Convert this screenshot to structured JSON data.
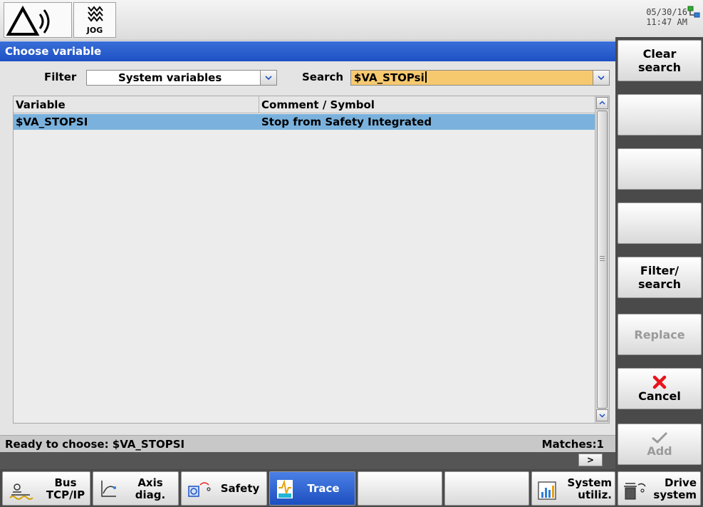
{
  "header": {
    "mode_label": "JOG",
    "date": "05/30/16",
    "time": "11:47 AM"
  },
  "dialog": {
    "title": "Choose variable",
    "filter_label": "Filter",
    "filter_value": "System variables",
    "search_label": "Search",
    "search_value": "$VA_STOPsi",
    "columns": [
      "Variable",
      "Comment / Symbol"
    ],
    "rows": [
      {
        "variable": "$VA_STOPSI",
        "comment": "Stop from Safety Integrated"
      }
    ],
    "status_text": "Ready to choose: $VA_STOPSI",
    "matches_text": "Matches:1",
    "scroll_right_label": ">"
  },
  "vertical_softkeys": {
    "clear_search": [
      "Clear",
      "search"
    ],
    "filter_search": [
      "Filter/",
      "search"
    ],
    "replace": "Replace",
    "cancel": "Cancel",
    "add": "Add"
  },
  "horizontal_softkeys": {
    "bus": [
      "Bus",
      "TCP/IP"
    ],
    "axis": [
      "Axis",
      "diag."
    ],
    "safety": "Safety",
    "trace": "Trace",
    "system": [
      "System",
      "utiliz."
    ],
    "drive": [
      "Drive",
      "system"
    ]
  },
  "colors": {
    "title_bar": "#1e50c3",
    "selected_row": "#7ab2dd",
    "search_highlight": "#f7c96f",
    "active_softkey": "#1d4fbf",
    "cancel_icon": "#e8141b"
  },
  "icons": [
    "alarm-bell-icon",
    "jog-mode-icon",
    "network-status-icon",
    "red-x-cancel-icon",
    "checkmark-icon",
    "bus-network-icon",
    "axis-diag-icon",
    "safety-icon",
    "trace-icon",
    "system-utilization-icon",
    "drive-system-icon"
  ]
}
